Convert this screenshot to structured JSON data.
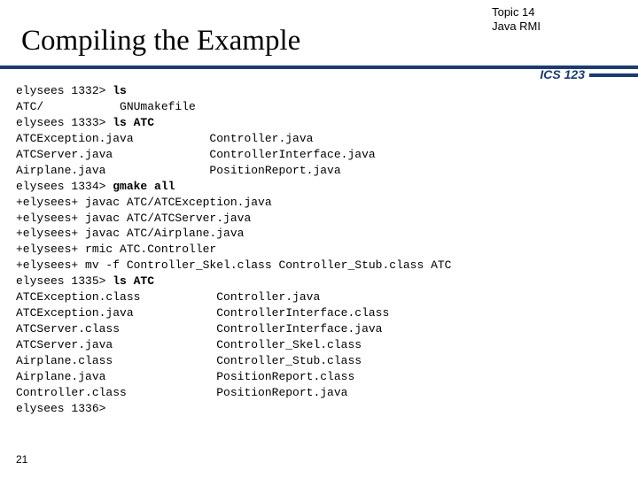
{
  "header": {
    "topic_line1": "Topic 14",
    "topic_line2": "Java RMI",
    "title": "Compiling the Example",
    "course": "ICS 123"
  },
  "terminal": {
    "p1": "elysees 1332> ",
    "c1": "ls",
    "l2": "ATC/           GNUmakefile",
    "p3": "elysees 1333> ",
    "c3": "ls ATC",
    "l4": "ATCException.java           Controller.java",
    "l5": "ATCServer.java              ControllerInterface.java",
    "l6": "Airplane.java               PositionReport.java",
    "p7": "elysees 1334> ",
    "c7": "gmake all",
    "l8": "+elysees+ javac ATC/ATCException.java",
    "l9": "+elysees+ javac ATC/ATCServer.java",
    "l10": "+elysees+ javac ATC/Airplane.java",
    "l11": "+elysees+ rmic ATC.Controller",
    "l12": "+elysees+ mv -f Controller_Skel.class Controller_Stub.class ATC",
    "p13": "elysees 1335> ",
    "c13": "ls ATC",
    "l14": "ATCException.class           Controller.java",
    "l15": "ATCException.java            ControllerInterface.class",
    "l16": "ATCServer.class              ControllerInterface.java",
    "l17": "ATCServer.java               Controller_Skel.class",
    "l18": "Airplane.class               Controller_Stub.class",
    "l19": "Airplane.java                PositionReport.class",
    "l20": "Controller.class             PositionReport.java",
    "l21": "elysees 1336>"
  },
  "footer": {
    "page": "21"
  }
}
